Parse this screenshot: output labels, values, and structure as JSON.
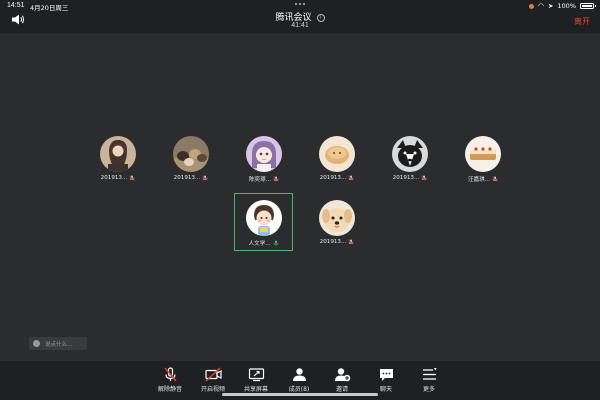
{
  "status": {
    "time": "14:51",
    "date": "4月20日周三",
    "battery": "100%"
  },
  "header": {
    "title": "腾讯会议",
    "timer": "41:41",
    "leave_label": "离开"
  },
  "participants": [
    {
      "name": "201913...",
      "avatar": "avatar-person-dark-hair"
    },
    {
      "name": "201913...",
      "avatar": "avatar-cats-group"
    },
    {
      "name": "陈奕璟...",
      "avatar": "avatar-anime-girl"
    },
    {
      "name": "201913...",
      "avatar": "avatar-bread-pastry"
    },
    {
      "name": "201913...",
      "avatar": "avatar-black-white-dog"
    },
    {
      "name": "汪嘉琪...",
      "avatar": "avatar-cake-slice"
    },
    {
      "name": "人文学...",
      "avatar": "avatar-cartoon-kid",
      "active": true
    },
    {
      "name": "201913...",
      "avatar": "avatar-fluffy-dog"
    }
  ],
  "chat": {
    "placeholder": "说点什么..."
  },
  "toolbar": {
    "unmute_label": "解除静音",
    "video_label": "开启视频",
    "share_label": "共享屏幕",
    "members_label": "成员(8)",
    "invite_label": "邀请",
    "chat_label": "聊天",
    "more_label": "更多"
  },
  "colors": {
    "leave": "#e5443b",
    "active_border": "#43b86a",
    "mic_on": "#43b86a",
    "mic_off": "#e5443b"
  }
}
